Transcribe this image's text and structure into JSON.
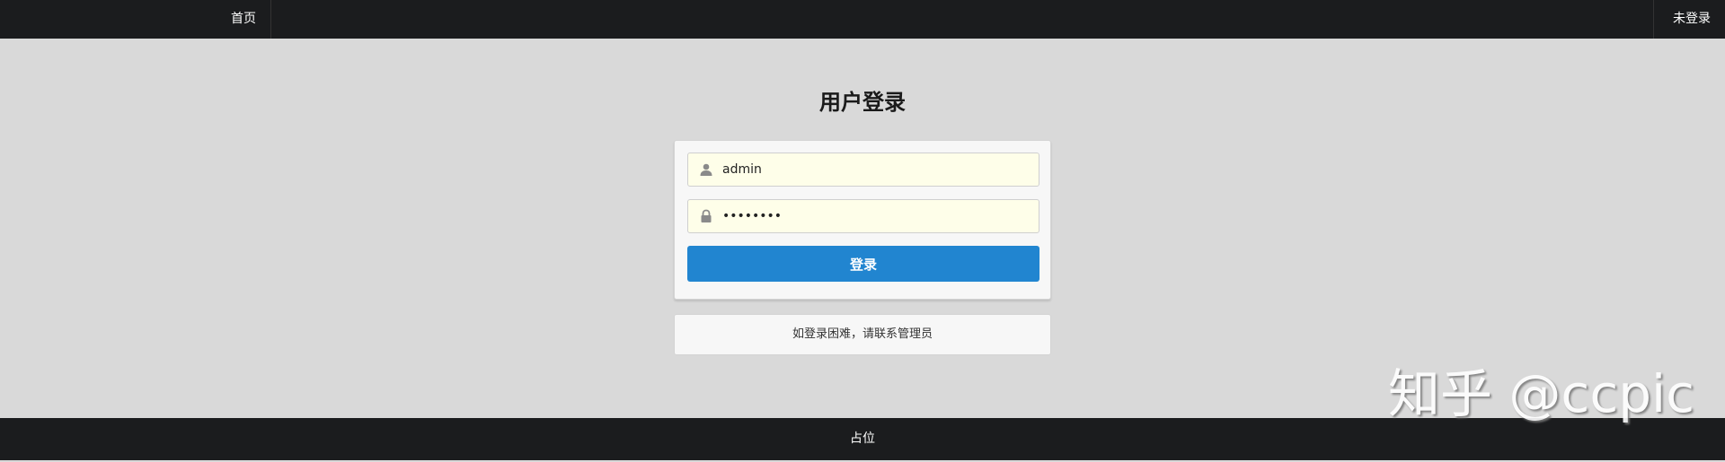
{
  "header": {
    "home_label": "首页",
    "user_status": "未登录"
  },
  "login": {
    "title": "用户登录",
    "username": {
      "value": "admin",
      "icon": "user-icon"
    },
    "password": {
      "value": "12345678",
      "icon": "lock-icon"
    },
    "submit_label": "登录"
  },
  "help": {
    "text": "如登录困难，请联系管理员"
  },
  "footer": {
    "text": "占位"
  },
  "watermark": {
    "text": "知乎 @ccpic"
  },
  "colors": {
    "background": "#d9d9d9",
    "navbar": "#1b1c1e",
    "primary_button": "#2185d0",
    "input_background": "#fefee9"
  }
}
